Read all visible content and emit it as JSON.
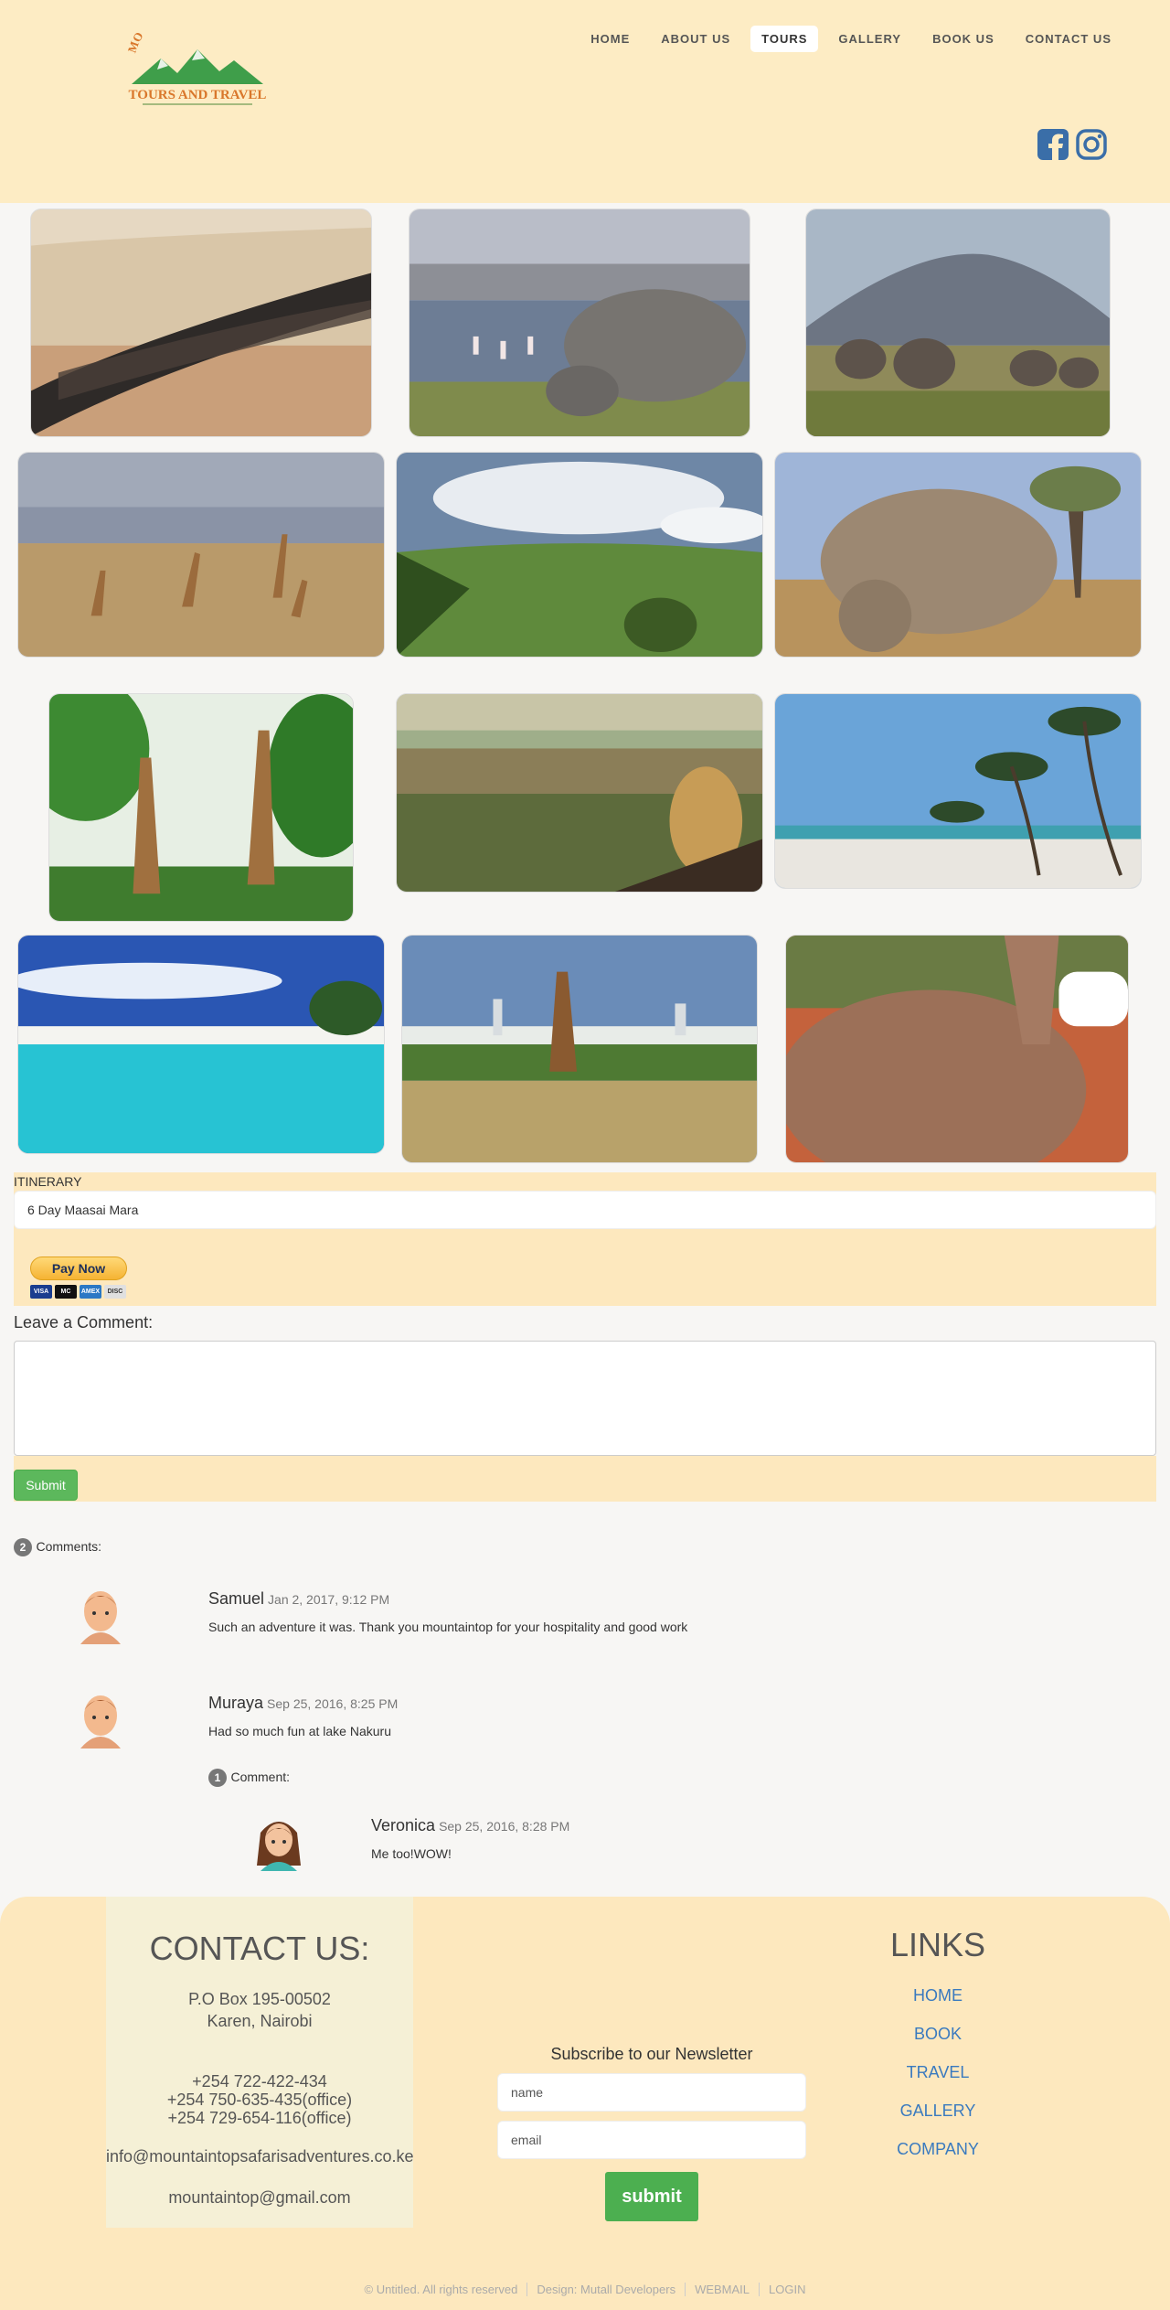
{
  "nav": {
    "items": [
      {
        "label": "HOME",
        "active": false
      },
      {
        "label": "ABOUT US",
        "active": false
      },
      {
        "label": "TOURS",
        "active": true
      },
      {
        "label": "GALLERY",
        "active": false
      },
      {
        "label": "BOOK US",
        "active": false
      },
      {
        "label": "CONTACT US",
        "active": false
      }
    ]
  },
  "logo": {
    "line1": "MOUNTAIN TOP SAFARIS",
    "line2": "TOURS AND TRAVEL"
  },
  "social": {
    "icons": [
      "facebook-icon",
      "instagram-icon"
    ]
  },
  "gallery": {
    "photos": [
      "wildebeest-migration",
      "rhino-lake-flamingos",
      "elephants-kilimanjaro",
      "giraffes-flamingo-lake",
      "crater-valley",
      "white-rhino",
      "giraffes-forest",
      "leopard-plains",
      "palm-beach",
      "turquoise-beach",
      "giraffe-city-skyline",
      "baby-elephant-bottle"
    ]
  },
  "itinerary": {
    "label": "ITINERARY",
    "value": "6 Day Maasai Mara"
  },
  "paypal": {
    "button": "Pay Now",
    "cards": [
      "VISA",
      "MC",
      "AMEX",
      "DISC"
    ]
  },
  "comment_form": {
    "label": "Leave a Comment:",
    "submit": "Submit"
  },
  "comments": {
    "count": "2",
    "count_label": "Comments:",
    "items": [
      {
        "name": "Samuel",
        "date": "Jan 2, 2017, 9:12 PM",
        "body": "Such an adventure it was. Thank you mountaintop for your hospitality and good work"
      },
      {
        "name": "Muraya",
        "date": "Sep 25, 2016, 8:25 PM",
        "body": "Had so much fun at lake Nakuru"
      }
    ],
    "reply_count": "1",
    "reply_label": "Comment:",
    "reply": {
      "name": "Veronica",
      "date": "Sep 25, 2016, 8:28 PM",
      "body": "Me too!WOW!"
    }
  },
  "footer": {
    "contact": {
      "title": "CONTACT US:",
      "address1": "P.O Box 195-00502",
      "address2": "Karen, Nairobi",
      "phone1": "+254 722-422-434",
      "phone2": "+254 750-635-435(office)",
      "phone3": "+254 729-654-116(office)",
      "email": "info@mountaintopsafarisadventures.co.ke",
      "gmail": "mountaintop@gmail.com"
    },
    "newsletter": {
      "title": "Subscribe to our Newsletter",
      "name_placeholder": "name",
      "email_placeholder": "email",
      "submit": "submit"
    },
    "links": {
      "title": "LINKS",
      "items": [
        "HOME",
        "BOOK",
        "TRAVEL",
        "GALLERY",
        "COMPANY"
      ]
    },
    "copyright": {
      "text": "© Untitled. All rights reserved",
      "design": "Design: Mutall Developers",
      "webmail": "WEBMAIL",
      "login": "LOGIN"
    }
  },
  "colors": {
    "header_bg": "#fdecc4",
    "accent_green": "#4caf50",
    "link_blue": "#3a7abf"
  }
}
